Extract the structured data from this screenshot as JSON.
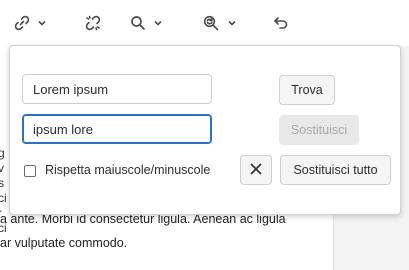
{
  "toolbar": {
    "buttons": [
      {
        "icon": "link-icon",
        "has_dropdown": true
      },
      {
        "icon": "unlink-icon",
        "has_dropdown": false
      },
      {
        "icon": "search-icon",
        "has_dropdown": true
      },
      {
        "icon": "find-replace-icon",
        "has_dropdown": true
      },
      {
        "icon": "undo-icon",
        "has_dropdown": false
      }
    ]
  },
  "find_replace": {
    "find_value": "Lorem ipsum",
    "replace_value": "ipsum lore",
    "find_button": "Trova",
    "replace_button": "Sostituisci",
    "replace_all_button": "Sostituisci tutto",
    "match_case_label": "Rispetta maiuscole/minuscole",
    "match_case_checked": false,
    "clear_icon": "close-icon"
  },
  "document": {
    "partial_lines": [
      "g",
      "v",
      "s",
      "ci",
      "r",
      "ci"
    ],
    "line_1": "a ante. Morbi id consectetur ligula. Aenean ac ligula",
    "line_2": "ar vulputate commodo."
  },
  "colors": {
    "focus_border": "#2f6fbf",
    "disabled_button_bg": "#e8e8e8",
    "panel_bg": "#f3f3f3"
  }
}
